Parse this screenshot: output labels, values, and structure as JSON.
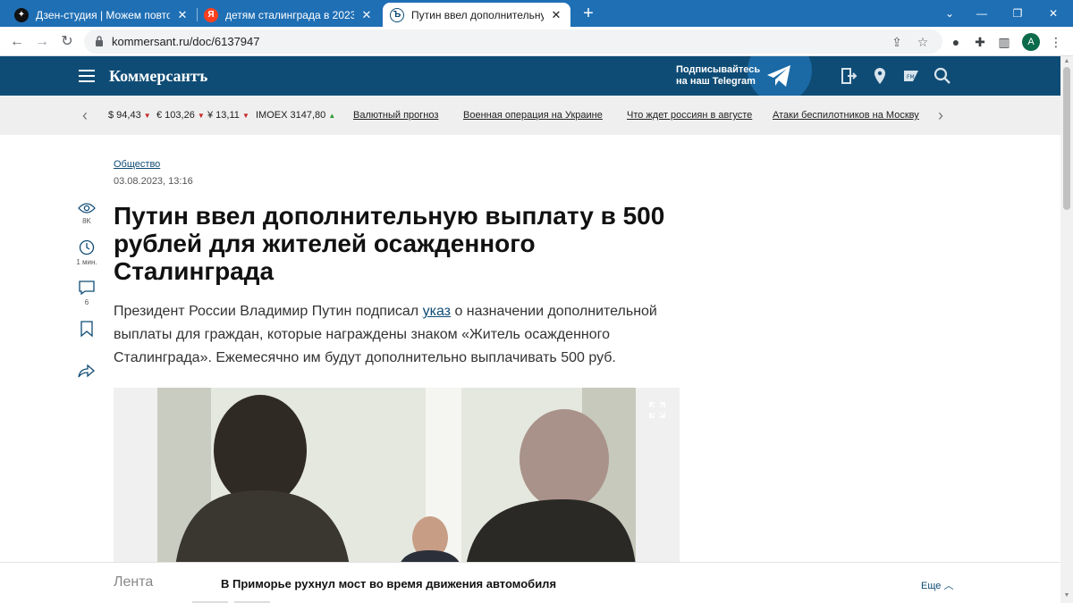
{
  "tabs": [
    {
      "title": "Дзен-студия | Можем повторит",
      "active": false
    },
    {
      "title": "детям сталинграда в 2023 году",
      "active": false
    },
    {
      "title": "Путин ввел дополнительную вы",
      "active": true
    }
  ],
  "browser": {
    "url": "kommersant.ru/doc/6137947",
    "profile_initial": "A"
  },
  "site": {
    "logo": "Коммерсантъ",
    "telegram_line1": "Подписывайтесь",
    "telegram_line2": "на наш Telegram",
    "brand_color": "#0f4c75"
  },
  "ticker": {
    "quotes": [
      {
        "label": "$ 94,43",
        "trend": "down"
      },
      {
        "label": "€ 103,26",
        "trend": "down"
      },
      {
        "label": "¥ 13,11",
        "trend": "down"
      },
      {
        "label": "IMOEX 3147,80",
        "trend": "up"
      }
    ],
    "links": [
      "Валютный прогноз",
      "Военная операция на Украине",
      "Что ждет россиян в августе",
      "Атаки беспилотников на Москву"
    ]
  },
  "article": {
    "rubric": "Общество",
    "date": "03.08.2023, 13:16",
    "title": "Путин ввел дополнительную выплату в 500 рублей для жителей осажденного Сталинграда",
    "lead_before": "Президент России Владимир Путин подписал ",
    "lead_link": "указ",
    "lead_after": " о назначении дополнительной выплаты для граждан, которые награждены знаком «Житель осажденного Сталинграда». Ежемесячно им будут дополнительно выплачивать 500 руб.",
    "views": "8K",
    "read_time": "1 мин.",
    "comments": "6"
  },
  "feed": {
    "label": "Лента",
    "headline": "В Приморье рухнул мост во время движения автомобиля",
    "more": "Еще"
  }
}
